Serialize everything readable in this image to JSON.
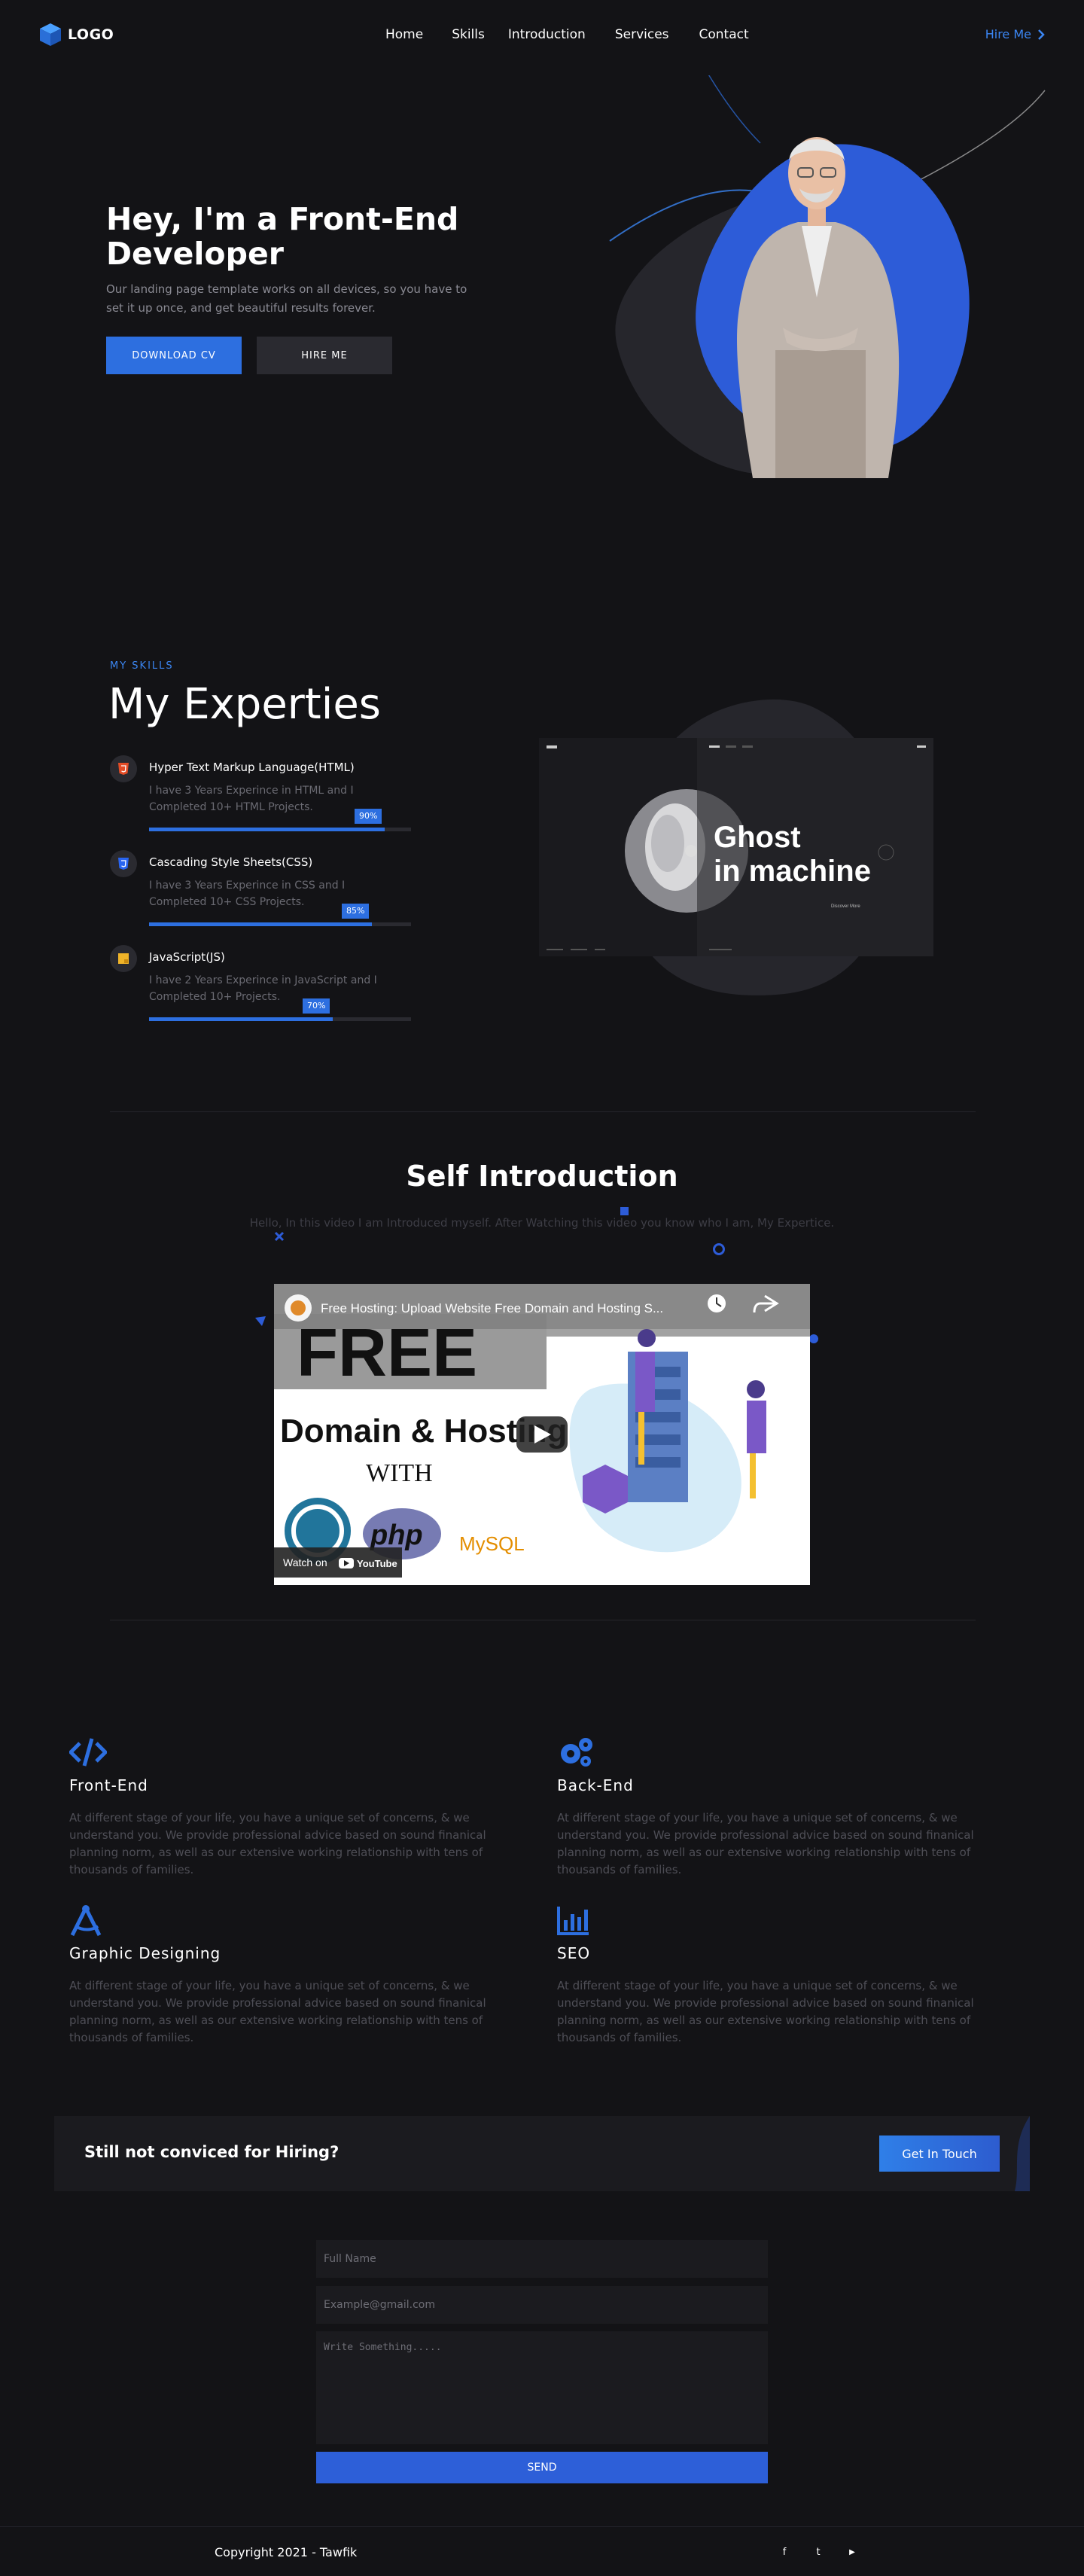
{
  "nav": {
    "logo": "LOGO",
    "links": [
      "Home",
      "Skills",
      "Introduction",
      "Services",
      "Contact"
    ],
    "hire": "Hire Me"
  },
  "hero": {
    "title": "Hey, I'm a Front-End Developer",
    "subtitle": "Our landing page template works on all devices, so you have to set it up once, and get beautiful results forever.",
    "download_label": "DOWNLOAD CV",
    "hire_label": "HIRE ME"
  },
  "skills": {
    "eyebrow": "MY SKILLS",
    "title": "My Experties",
    "items": [
      {
        "name": "Hyper Text Markup Language(HTML)",
        "desc": "I have 3 Years Experince in HTML and I Completed 10+ HTML Projects.",
        "percent": 90,
        "badge": "90%",
        "icon": "html5-icon"
      },
      {
        "name": "Cascading Style Sheets(CSS)",
        "desc": "I have 3 Years Experince in CSS and I Completed 10+ CSS Projects.",
        "percent": 85,
        "badge": "85%",
        "icon": "css3-icon"
      },
      {
        "name": "JavaScript(JS)",
        "desc": "I have 2 Years Experince in JavaScript and I Completed 10+ Projects.",
        "percent": 70,
        "badge": "70%",
        "icon": "javascript-icon"
      }
    ],
    "mock": {
      "headline_1": "Ghost",
      "headline_2": "in machine",
      "discover": "Discover More"
    }
  },
  "intro": {
    "title": "Self Introduction",
    "subtitle": "Hello, In this video I am Introduced myself. After Watching this video you know who I am, My Expertice.",
    "video": {
      "title": "Free Hosting: Upload Website Free Domain and Hosting S...",
      "big_text": "FREE",
      "domain_text": "Domain & Hosting",
      "with_text": "WITH",
      "php": "php",
      "mysql": "MySQL",
      "watch_on": "Watch on",
      "youtube": "YouTube"
    }
  },
  "services": [
    {
      "name": "Front-End",
      "desc": "At different stage of your life, you have a unique set of concerns, & we understand you. We provide professional advice based on sound finanical planning norm, as well as our extensive working relationship with tens of thousands of families.",
      "icon": "code-icon"
    },
    {
      "name": "Back-End",
      "desc": "At different stage of your life, you have a unique set of concerns, & we understand you. We provide professional advice based on sound finanical planning norm, as well as our extensive working relationship with tens of thousands of families.",
      "icon": "gears-icon"
    },
    {
      "name": "Graphic Designing",
      "desc": "At different stage of your life, you have a unique set of concerns, & we understand you. We provide professional advice based on sound finanical planning norm, as well as our extensive working relationship with tens of thousands of families.",
      "icon": "compass-drafting-icon"
    },
    {
      "name": "SEO",
      "desc": "At different stage of your life, you have a unique set of concerns, & we understand you. We provide professional advice based on sound finanical planning norm, as well as our extensive working relationship with tens of thousands of families.",
      "icon": "bar-chart-icon"
    }
  ],
  "cta": {
    "text": "Still not conviced for Hiring?",
    "button": "Get In Touch"
  },
  "contact": {
    "name_placeholder": "Full Name",
    "email_placeholder": "Example@gmail.com",
    "message_placeholder": "Write Something.....",
    "send": "SEND"
  },
  "footer": {
    "copyright": "Copyright 2021 - Tawfik",
    "social": [
      {
        "icon": "facebook-icon",
        "glyph": "f"
      },
      {
        "icon": "twitter-icon",
        "glyph": "t"
      },
      {
        "icon": "youtube-icon",
        "glyph": "▶"
      }
    ]
  },
  "colors": {
    "accent": "#2d6fe0",
    "link": "#3b86f3",
    "background": "#131316",
    "panel": "#1b1b1f"
  }
}
